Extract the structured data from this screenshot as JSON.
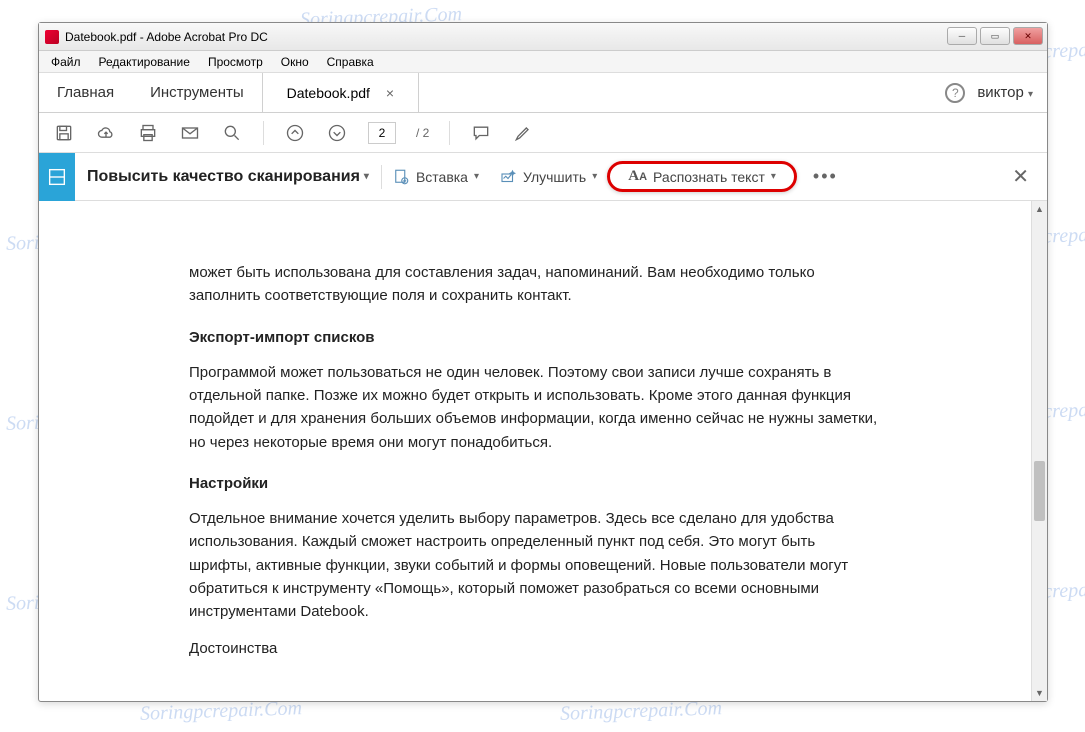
{
  "watermark": "Soringpcrepair.Com",
  "window_title": "Datebook.pdf - Adobe Acrobat Pro DC",
  "menubar": {
    "file": "Файл",
    "edit": "Редактирование",
    "view": "Просмотр",
    "window": "Окно",
    "help": "Справка"
  },
  "tabs": {
    "home": "Главная",
    "tools": "Инструменты",
    "doc": "Datebook.pdf"
  },
  "user": "виктор",
  "pages": {
    "current": "2",
    "total": "/ 2"
  },
  "toolbar2": {
    "quality": "Повысить качество сканирования",
    "insert": "Вставка",
    "enhance": "Улучшить",
    "recognize": "Распознать текст"
  },
  "doc": {
    "p1": "может быть использована для составления задач, напоминаний. Вам необходимо только заполнить соответствующие поля и сохранить контакт.",
    "h1": "Экспорт-импорт списков",
    "p2": "Программой может пользоваться не один человек. Поэтому свои записи лучше сохранять в отдельной папке. Позже их можно будет открыть и использовать. Кроме этого данная функция подойдет и для хранения больших объемов информации, когда именно сейчас не нужны заметки, но через некоторые время они могут понадобиться.",
    "h2": "Настройки",
    "p3": "Отдельное внимание хочется уделить выбору параметров. Здесь все сделано для удобства использования. Каждый сможет настроить определенный пункт под себя. Это могут быть шрифты, активные функции, звуки событий и формы оповещений. Новые пользователи могут обратиться к инструменту «Помощь», который поможет разобраться со всеми основными инструментами Datebook.",
    "h3": "Достоинства"
  }
}
